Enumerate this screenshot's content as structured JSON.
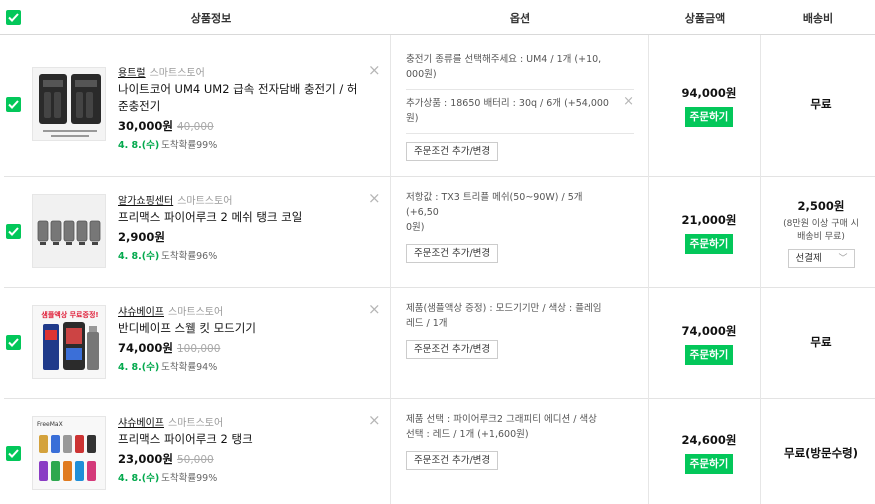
{
  "header": {
    "col_product": "상품정보",
    "col_option": "옵션",
    "col_amount": "상품금액",
    "col_shipping": "배송비"
  },
  "colors": {
    "accent": "#03c75a",
    "arrival": "#03a94d"
  },
  "items": [
    {
      "store": "용트럴",
      "store_type": "스마트스토어",
      "name_line1": "나이트코어 UM4 UM2 급속 전자담배 충전기 / 허",
      "name_line2": "준충전기",
      "price": "30,000원",
      "original_price": "40,000",
      "arrival_date": "4. 8.(수)",
      "arrival_prob": "도착확률99%",
      "options": [
        {
          "line1": "충전기 종류를 선택해주세요 : UM4 / 1개 (+10,",
          "line2": "000원)"
        },
        {
          "line1": "추가상품 : 18650 배터리 : 30q / 6개 (+54,000",
          "line2": "원)"
        }
      ],
      "option_button": "주문조건 추가/변경",
      "amount": "94,000원",
      "order_button": "주문하기",
      "shipping": "무료"
    },
    {
      "store": "알가쇼핑센터",
      "store_type": "스마트스토어",
      "name_line1": "프리맥스 파이어루크 2 메쉬 탱크 코일",
      "name_line2": "",
      "price": "2,900원",
      "original_price": "",
      "arrival_date": "4. 8.(수)",
      "arrival_prob": "도착확률96%",
      "options": [
        {
          "line1": "저항값 : TX3 트리플 메쉬(50~90W) / 5개 (+6,50",
          "line2": "0원)"
        }
      ],
      "option_button": "주문조건 추가/변경",
      "amount": "21,000원",
      "order_button": "주문하기",
      "shipping": "2,500원",
      "shipping_note_1": "(8만원 이상 구매 시",
      "shipping_note_2": "배송비 무료)",
      "shipping_select": "선결제"
    },
    {
      "store": "샤슈베이프",
      "store_type": "스마트스토어",
      "name_line1": "반디베이프 스웰 킷 모드기기",
      "name_line2": "",
      "price": "74,000원",
      "original_price": "100,000",
      "arrival_date": "4. 8.(수)",
      "arrival_prob": "도착확률94%",
      "thumb_text": "샘플액상 무료증정!",
      "options": [
        {
          "line1": "제품(샘플액상 증정) : 모드기기만 / 색상 : 플레임",
          "line2": "레드 / 1개"
        }
      ],
      "option_button": "주문조건 추가/변경",
      "amount": "74,000원",
      "order_button": "주문하기",
      "shipping": "무료"
    },
    {
      "store": "샤슈베이프",
      "store_type": "스마트스토어",
      "name_line1": "프리맥스 파이어루크 2 탱크",
      "name_line2": "",
      "price": "23,000원",
      "original_price": "50,000",
      "arrival_date": "4. 8.(수)",
      "arrival_prob": "도착확률99%",
      "thumb_brand": "FreeMaX",
      "options": [
        {
          "line1": "제품 선택 : 파이어루크2 그래피티 에디션 / 색상",
          "line2": "선택 : 레드 / 1개 (+1,600원)"
        }
      ],
      "option_button": "주문조건 추가/변경",
      "amount": "24,600원",
      "order_button": "주문하기",
      "shipping": "무료(방문수령)"
    }
  ]
}
